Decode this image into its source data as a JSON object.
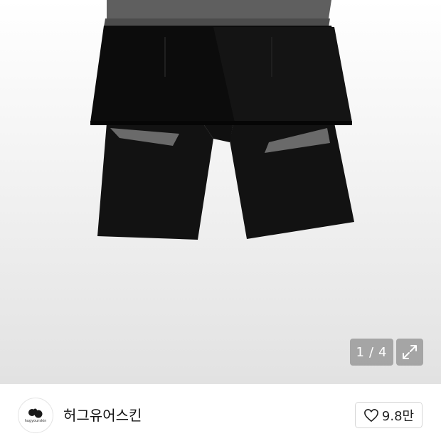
{
  "gallery": {
    "current_page": "1",
    "separator": "/",
    "total_pages": "4",
    "expand_icon": "expand-arrows-icon"
  },
  "shop": {
    "logo_text": "hugyourskin",
    "logo_icon": "hug-logo-icon",
    "name": "허그유어스킨",
    "like_icon": "heart-outline-icon",
    "like_count": "9.8만"
  }
}
